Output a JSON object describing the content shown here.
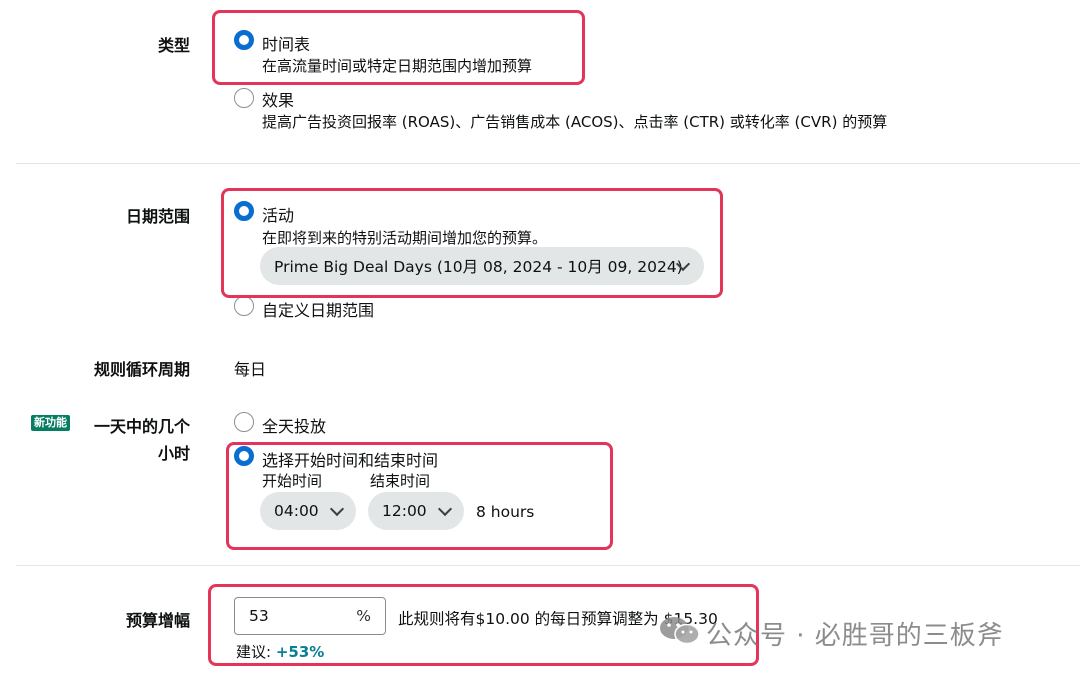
{
  "type": {
    "label": "类型",
    "options": [
      {
        "title": "时间表",
        "desc": "在高流量时间或特定日期范围内增加预算",
        "selected": true
      },
      {
        "title": "效果",
        "desc": "提高广告投资回报率 (ROAS)、广告销售成本 (ACOS)、点击率 (CTR) 或转化率 (CVR) 的预算",
        "selected": false
      }
    ]
  },
  "date_range": {
    "label": "日期范围",
    "options": [
      {
        "title": "活动",
        "desc": "在即将到来的特别活动期间增加您的预算。",
        "selected": true
      },
      {
        "title": "自定义日期范围",
        "selected": false
      }
    ],
    "event_select": "Prime Big Deal Days (10月 08, 2024 - 10月 09, 2024)"
  },
  "recurrence": {
    "label": "规则循环周期",
    "value": "每日"
  },
  "hours": {
    "badge": "新功能",
    "label_line1": "一天中的几个",
    "label_line2": "小时",
    "options": [
      {
        "title": "全天投放",
        "selected": false
      },
      {
        "title": "选择开始时间和结束时间",
        "selected": true
      }
    ],
    "start_label": "开始时间",
    "end_label": "结束时间",
    "start_value": "04:00",
    "end_value": "12:00",
    "duration": "8 hours"
  },
  "budget": {
    "label": "预算增幅",
    "value": "53",
    "unit": "%",
    "summary": "此规则将有$10.00 的每日预算调整为 $15.30",
    "suggest_label": "建议:",
    "suggest_value": "+53%"
  },
  "watermark": "公众号 · 必胜哥的三板斧",
  "colors": {
    "accent": "#0a6ed1",
    "highlight": "#e4345a",
    "badge": "#067d62",
    "link": "#0a7e96"
  }
}
